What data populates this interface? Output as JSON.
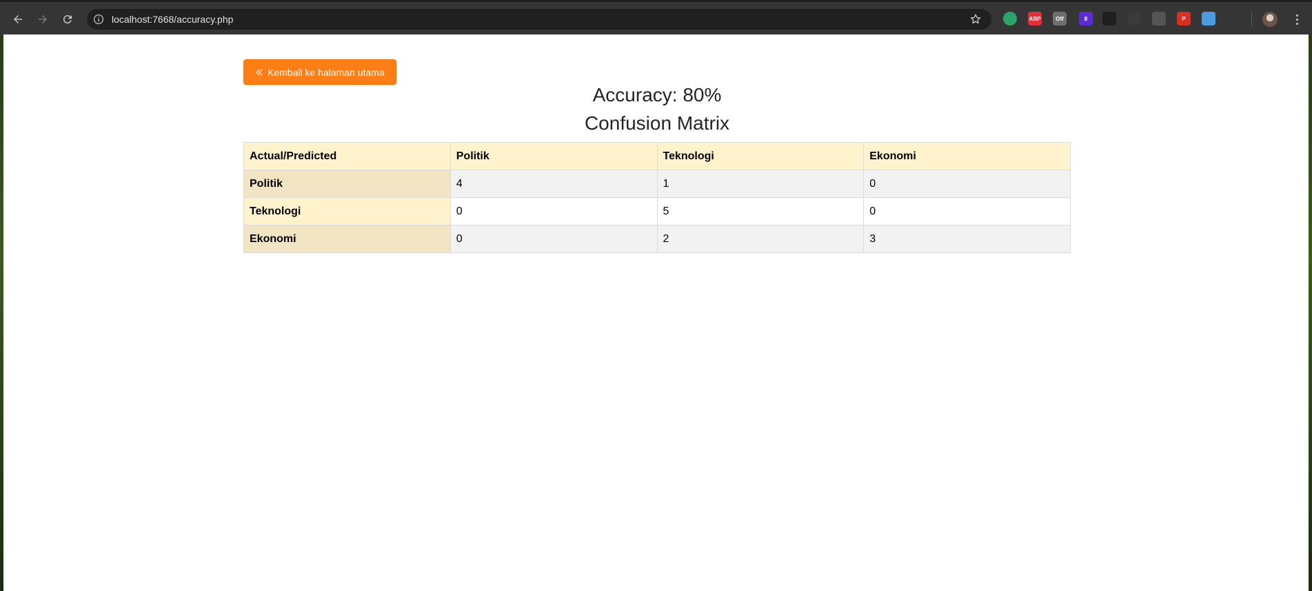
{
  "browser": {
    "url": "localhost:7668/accuracy.php",
    "extensions": [
      {
        "name": "grammarly-extension-icon",
        "color": "#2aa56a",
        "text": ""
      },
      {
        "name": "adblock-extension-icon",
        "color": "#e0303a",
        "text": "ABP"
      },
      {
        "name": "off-extension-icon",
        "color": "#6f6f6f",
        "text": "Off"
      },
      {
        "name": "purple-extension-icon",
        "color": "#5b2bd4",
        "text": "8"
      },
      {
        "name": "terminal-extension-icon",
        "color": "#1e1e1e",
        "text": ""
      },
      {
        "name": "target-extension-icon",
        "color": "#3a3a3a",
        "text": ""
      },
      {
        "name": "gray-extension-icon",
        "color": "#555555",
        "text": ""
      },
      {
        "name": "pdf-extension-icon",
        "color": "#d93025",
        "text": "P"
      },
      {
        "name": "blue-extension-icon",
        "color": "#4a9be0",
        "text": ""
      },
      {
        "name": "puzzle-extension-icon",
        "color": "#353535",
        "text": ""
      }
    ]
  },
  "page": {
    "back_button_label": "Kembali ke halaman utama",
    "accuracy_title": "Accuracy: 80%",
    "matrix_title": "Confusion Matrix",
    "colors": {
      "button": "#fd7e14",
      "header_bg": "#fff3cd",
      "row_header_bg": "#f2e5c3"
    }
  },
  "matrix": {
    "corner": "Actual/Predicted",
    "columns": [
      "Politik",
      "Teknologi",
      "Ekonomi"
    ],
    "rows": [
      {
        "label": "Politik",
        "values": [
          "4",
          "1",
          "0"
        ]
      },
      {
        "label": "Teknologi",
        "values": [
          "0",
          "5",
          "0"
        ]
      },
      {
        "label": "Ekonomi",
        "values": [
          "0",
          "2",
          "3"
        ]
      }
    ]
  }
}
